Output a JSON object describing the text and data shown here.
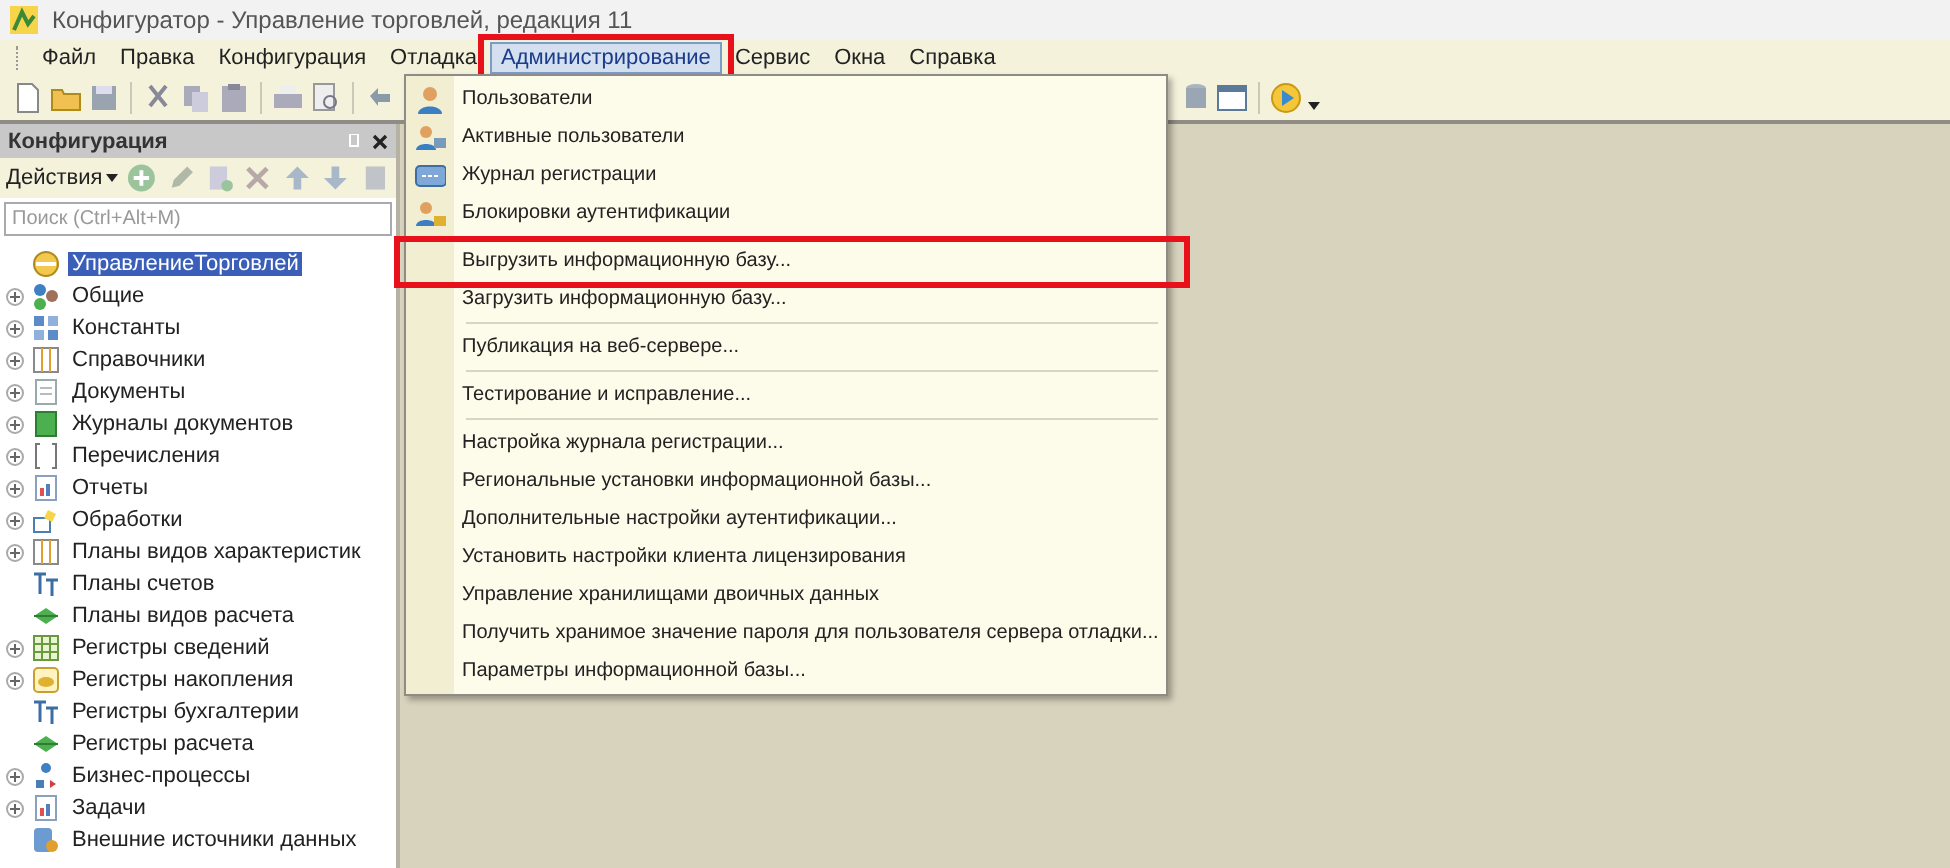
{
  "window": {
    "title": "Конфигуратор - Управление торговлей, редакция 11"
  },
  "menu_bar": [
    {
      "label": "Файл",
      "selected": false
    },
    {
      "label": "Правка",
      "selected": false
    },
    {
      "label": "Конфигурация",
      "selected": false
    },
    {
      "label": "Отладка",
      "selected": false
    },
    {
      "label": "Администрирование",
      "selected": true,
      "annotated": true
    },
    {
      "label": "Сервис",
      "selected": false
    },
    {
      "label": "Окна",
      "selected": false
    },
    {
      "label": "Справка",
      "selected": false
    }
  ],
  "config_panel": {
    "title": "Конфигурация",
    "actions_label": "Действия",
    "search": {
      "placeholder": "Поиск (Ctrl+Alt+M)"
    },
    "tree": [
      {
        "label": "УправлениеТорговлей",
        "selected": true,
        "children": [
          {
            "label": "Общие",
            "expandable": true,
            "selected": false
          },
          {
            "label": "Константы",
            "expandable": true,
            "selected": false
          },
          {
            "label": "Справочники",
            "expandable": true,
            "selected": false
          },
          {
            "label": "Документы",
            "expandable": true,
            "selected": false
          },
          {
            "label": "Журналы документов",
            "expandable": true,
            "selected": false
          },
          {
            "label": "Перечисления",
            "expandable": true,
            "selected": false
          },
          {
            "label": "Отчеты",
            "expandable": true,
            "selected": false
          },
          {
            "label": "Обработки",
            "expandable": true,
            "selected": false
          },
          {
            "label": "Планы видов характеристик",
            "expandable": true,
            "selected": false
          },
          {
            "label": "Планы счетов",
            "expandable": false,
            "selected": false
          },
          {
            "label": "Планы видов расчета",
            "expandable": false,
            "selected": false
          },
          {
            "label": "Регистры сведений",
            "expandable": true,
            "selected": false
          },
          {
            "label": "Регистры накопления",
            "expandable": true,
            "selected": false
          },
          {
            "label": "Регистры бухгалтерии",
            "expandable": false,
            "selected": false
          },
          {
            "label": "Регистры расчета",
            "expandable": false,
            "selected": false
          },
          {
            "label": "Бизнес-процессы",
            "expandable": true,
            "selected": false
          },
          {
            "label": "Задачи",
            "expandable": true,
            "selected": false
          },
          {
            "label": "Внешние источники данных",
            "expandable": false,
            "selected": false
          }
        ]
      }
    ]
  },
  "dropdown": {
    "groups": [
      [
        {
          "label": "Пользователи"
        },
        {
          "label": "Активные пользователи"
        },
        {
          "label": "Журнал регистрации"
        },
        {
          "label": "Блокировки аутентификации"
        }
      ],
      [
        {
          "label": "Выгрузить информационную базу...",
          "annotated": true
        },
        {
          "label": "Загрузить информационную базу..."
        }
      ],
      [
        {
          "label": "Публикация на веб-сервере..."
        }
      ],
      [
        {
          "label": "Тестирование и исправление..."
        }
      ],
      [
        {
          "label": "Настройка журнала регистрации..."
        },
        {
          "label": "Региональные установки информационной базы..."
        },
        {
          "label": "Дополнительные настройки аутентификации..."
        },
        {
          "label": "Установить настройки клиента лицензирования"
        },
        {
          "label": "Управление хранилищами двоичных данных"
        },
        {
          "label": "Получить хранимое значение пароля для пользователя сервера отладки..."
        },
        {
          "label": "Параметры информационной базы..."
        }
      ]
    ]
  }
}
